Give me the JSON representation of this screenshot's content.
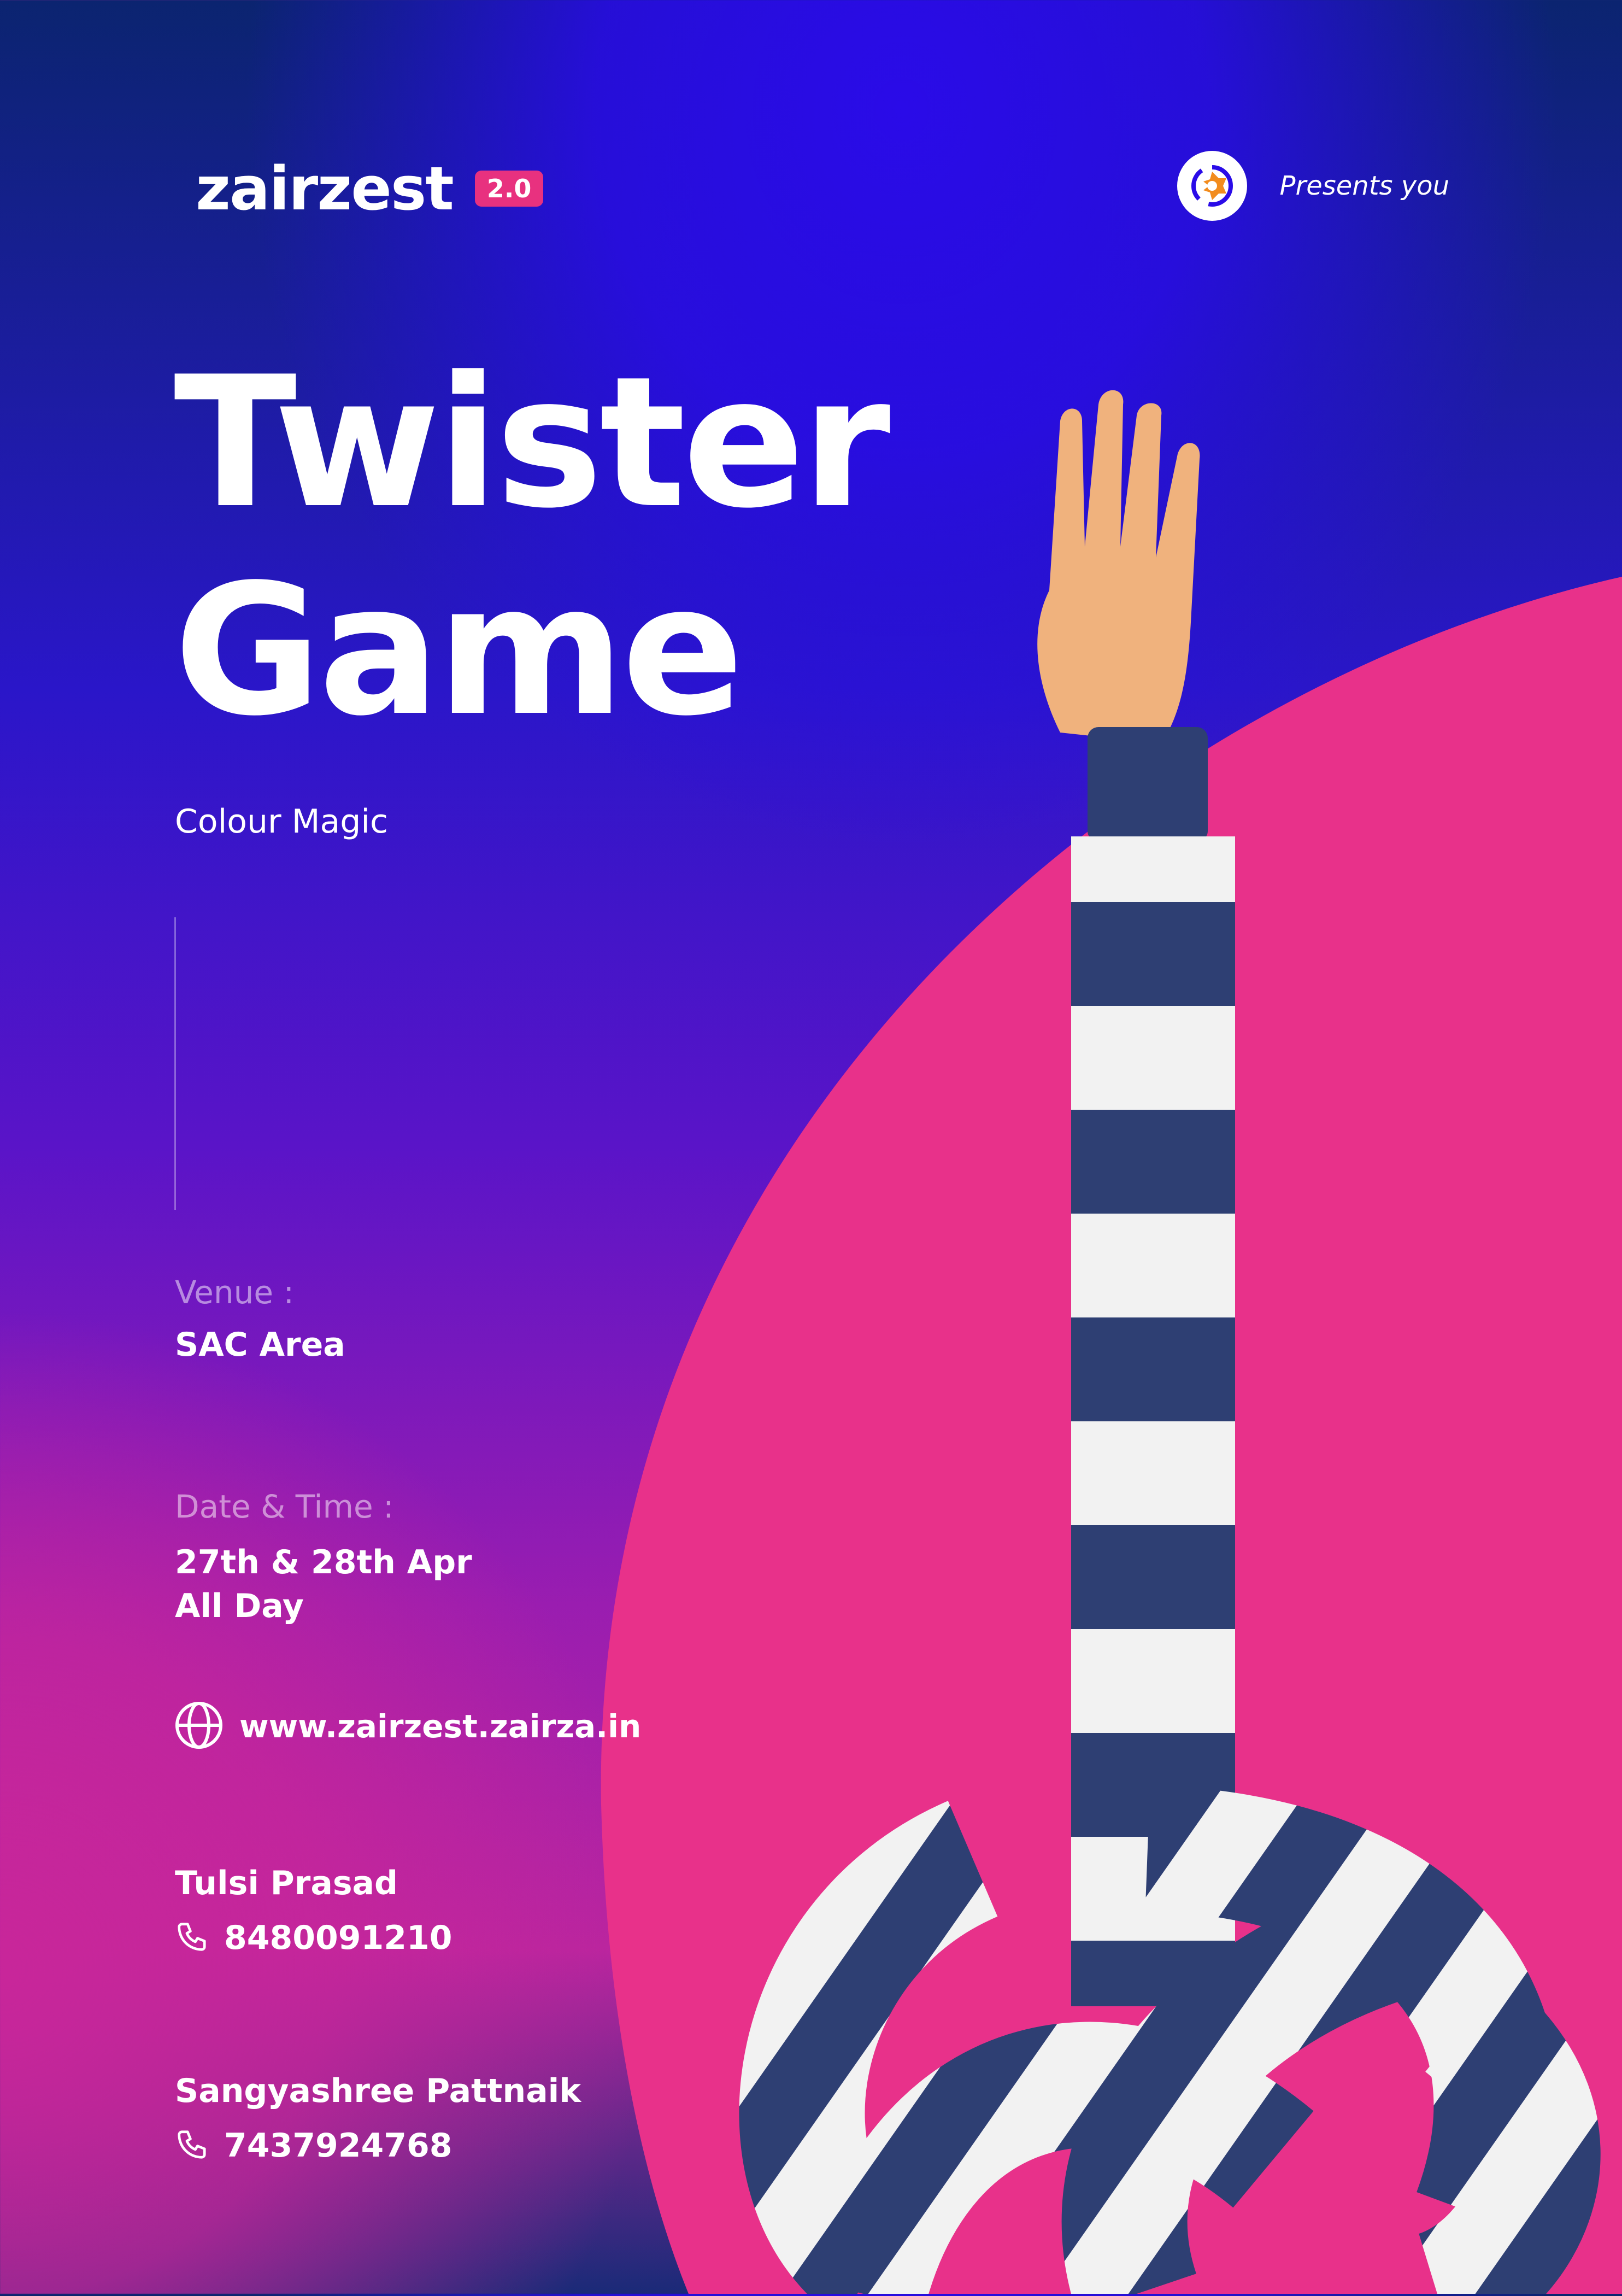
{
  "brand": {
    "name": "zairzest",
    "badge": "2.0"
  },
  "presenter": {
    "text": "Presents you",
    "logo_icon": "gear-puzzle-logo"
  },
  "event": {
    "title_line1": "Twister",
    "title_line2": "Game",
    "subtitle": "Colour Magic"
  },
  "venue": {
    "label": "Venue :",
    "value": "SAC Area"
  },
  "datetime": {
    "label": "Date & Time :",
    "line1": "27th & 28th Apr",
    "line2": "All Day"
  },
  "website": {
    "icon": "globe-icon",
    "url": "www.zairzest.zairza.in"
  },
  "contacts": [
    {
      "name": "Tulsi Prasad",
      "phone": "8480091210",
      "icon": "phone-icon"
    },
    {
      "name": "Sangyashree Pattnaik",
      "phone": "7437924768",
      "icon": "phone-icon"
    }
  ],
  "colors": {
    "accent_pink": "#E8318A",
    "deep_blue": "#2A0BE8",
    "navy": "#0B2470",
    "stripe_navy": "#2E3F73",
    "stripe_white": "#F2F2F2",
    "skin": "#F0B27D"
  }
}
